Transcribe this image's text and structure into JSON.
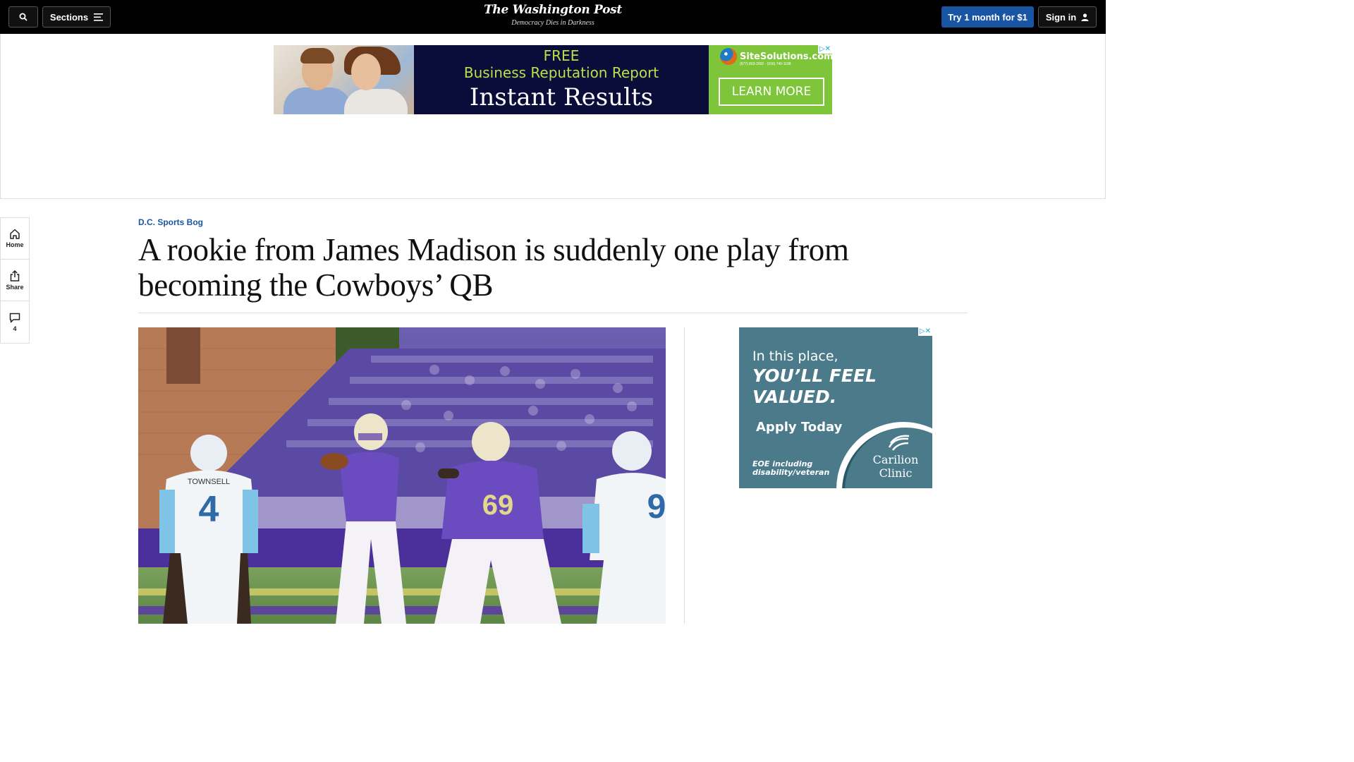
{
  "header": {
    "search_label": "",
    "sections_label": "Sections",
    "masthead": "The Washington Post",
    "tagline": "Democracy Dies in Darkness",
    "try_label": "Try 1 month for $1",
    "signin_label": "Sign in"
  },
  "top_ad": {
    "line1": "FREE",
    "line2": "Business Reputation Report",
    "line3": "Instant Results",
    "brand": "SiteSolutions.com",
    "phone": "(877) 803-2002 · (916) 740-1198",
    "cta": "LEARN MORE",
    "adchoice": "▷✕"
  },
  "rail": {
    "home": "Home",
    "share": "Share",
    "comments": "4"
  },
  "article": {
    "kicker": "D.C. Sports Bog",
    "title": "A rookie from James Madison is suddenly one play from becoming the Cowboys’ QB",
    "jersey_left_name": "TOWNSELL",
    "jersey_left_number": "4",
    "jersey_center_number": "69",
    "jersey_right_number": "9"
  },
  "side_ad": {
    "line1": "In this place,",
    "line2": "YOU’LL FEEL",
    "line3": "VALUED.",
    "cta": "Apply Today",
    "fine": "EOE including disability/veteran",
    "brand_line1": "Carilion",
    "brand_line2": "Clinic",
    "adchoice": "▷✕"
  },
  "colors": {
    "accent": "#1955a5",
    "topbar": "#000000",
    "ad_green": "#7fc53a",
    "side_ad_bg": "#4b7a8a"
  }
}
